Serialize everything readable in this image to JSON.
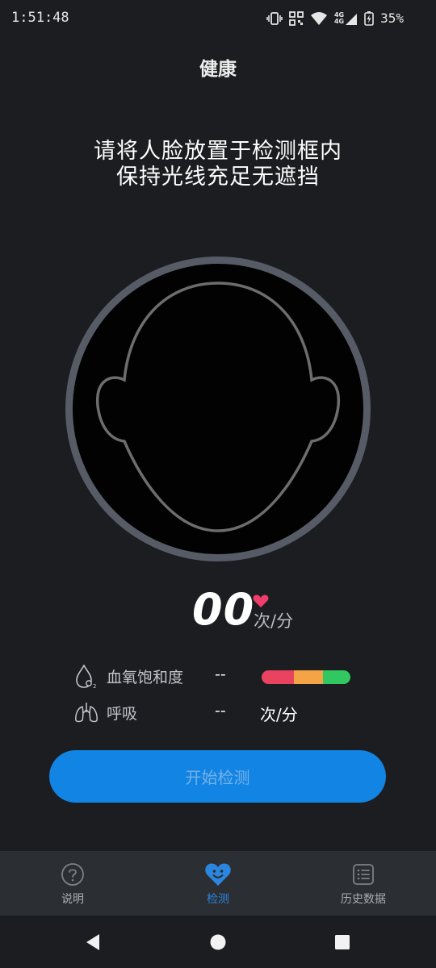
{
  "status_bar": {
    "time": "1:51:48",
    "network_label": "4G",
    "battery_percent": "35%"
  },
  "header": {
    "title": "健康"
  },
  "instructions": {
    "line1": "请将人脸放置于检测框内",
    "line2": "保持光线充足无遮挡"
  },
  "heart_rate": {
    "value": "00",
    "unit": "次/分",
    "heart_color": "#ef3d6c"
  },
  "metrics": {
    "spo2": {
      "label": "血氧饱和度",
      "value": "--",
      "icon": "drop-o2-icon",
      "bar_colors": [
        "#e9435f",
        "#f4a345",
        "#31c862"
      ]
    },
    "respiration": {
      "label": "呼吸",
      "value": "--",
      "unit": "次/分",
      "icon": "lungs-icon"
    }
  },
  "start_button": {
    "label": "开始检测",
    "color": "#1284e4"
  },
  "bottom_nav": {
    "items": [
      {
        "label": "说明",
        "icon": "question-circle-icon",
        "active": false
      },
      {
        "label": "检测",
        "icon": "heart-smile-icon",
        "active": true
      },
      {
        "label": "历史数据",
        "icon": "list-icon",
        "active": false
      }
    ],
    "active_color": "#2a86df"
  },
  "system_nav": {
    "icons": [
      "back-icon",
      "home-icon",
      "recents-icon"
    ]
  }
}
